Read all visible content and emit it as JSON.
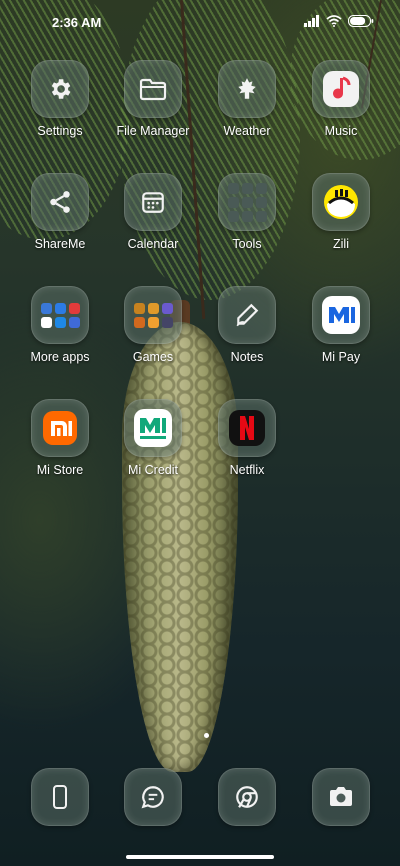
{
  "status": {
    "time": "2:36 AM",
    "battery_percent": 80
  },
  "apps": [
    {
      "label": "Settings",
      "icon": "gear-icon"
    },
    {
      "label": "File Manager",
      "icon": "folder-icon"
    },
    {
      "label": "Weather",
      "icon": "maple-leaf-icon"
    },
    {
      "label": "Music",
      "icon": "music-note-icon"
    },
    {
      "label": "ShareMe",
      "icon": "share-icon"
    },
    {
      "label": "Calendar",
      "icon": "calendar-icon"
    },
    {
      "label": "Tools",
      "icon": "tools-folder-icon"
    },
    {
      "label": "Zili",
      "icon": "zili-icon"
    },
    {
      "label": "More apps",
      "icon": "more-apps-folder-icon"
    },
    {
      "label": "Games",
      "icon": "games-folder-icon"
    },
    {
      "label": "Notes",
      "icon": "pen-icon"
    },
    {
      "label": "Mi Pay",
      "icon": "mi-pay-icon"
    },
    {
      "label": "Mi Store",
      "icon": "mi-logo-icon"
    },
    {
      "label": "Mi Credit",
      "icon": "mi-credit-icon"
    },
    {
      "label": "Netflix",
      "icon": "netflix-icon"
    }
  ],
  "dock": [
    {
      "name": "phone",
      "icon": "phone-icon"
    },
    {
      "name": "messages",
      "icon": "chat-bubble-icon"
    },
    {
      "name": "chrome",
      "icon": "chrome-icon"
    },
    {
      "name": "camera",
      "icon": "camera-icon"
    }
  ],
  "page_indicator": {
    "current": 1,
    "total": 1
  }
}
